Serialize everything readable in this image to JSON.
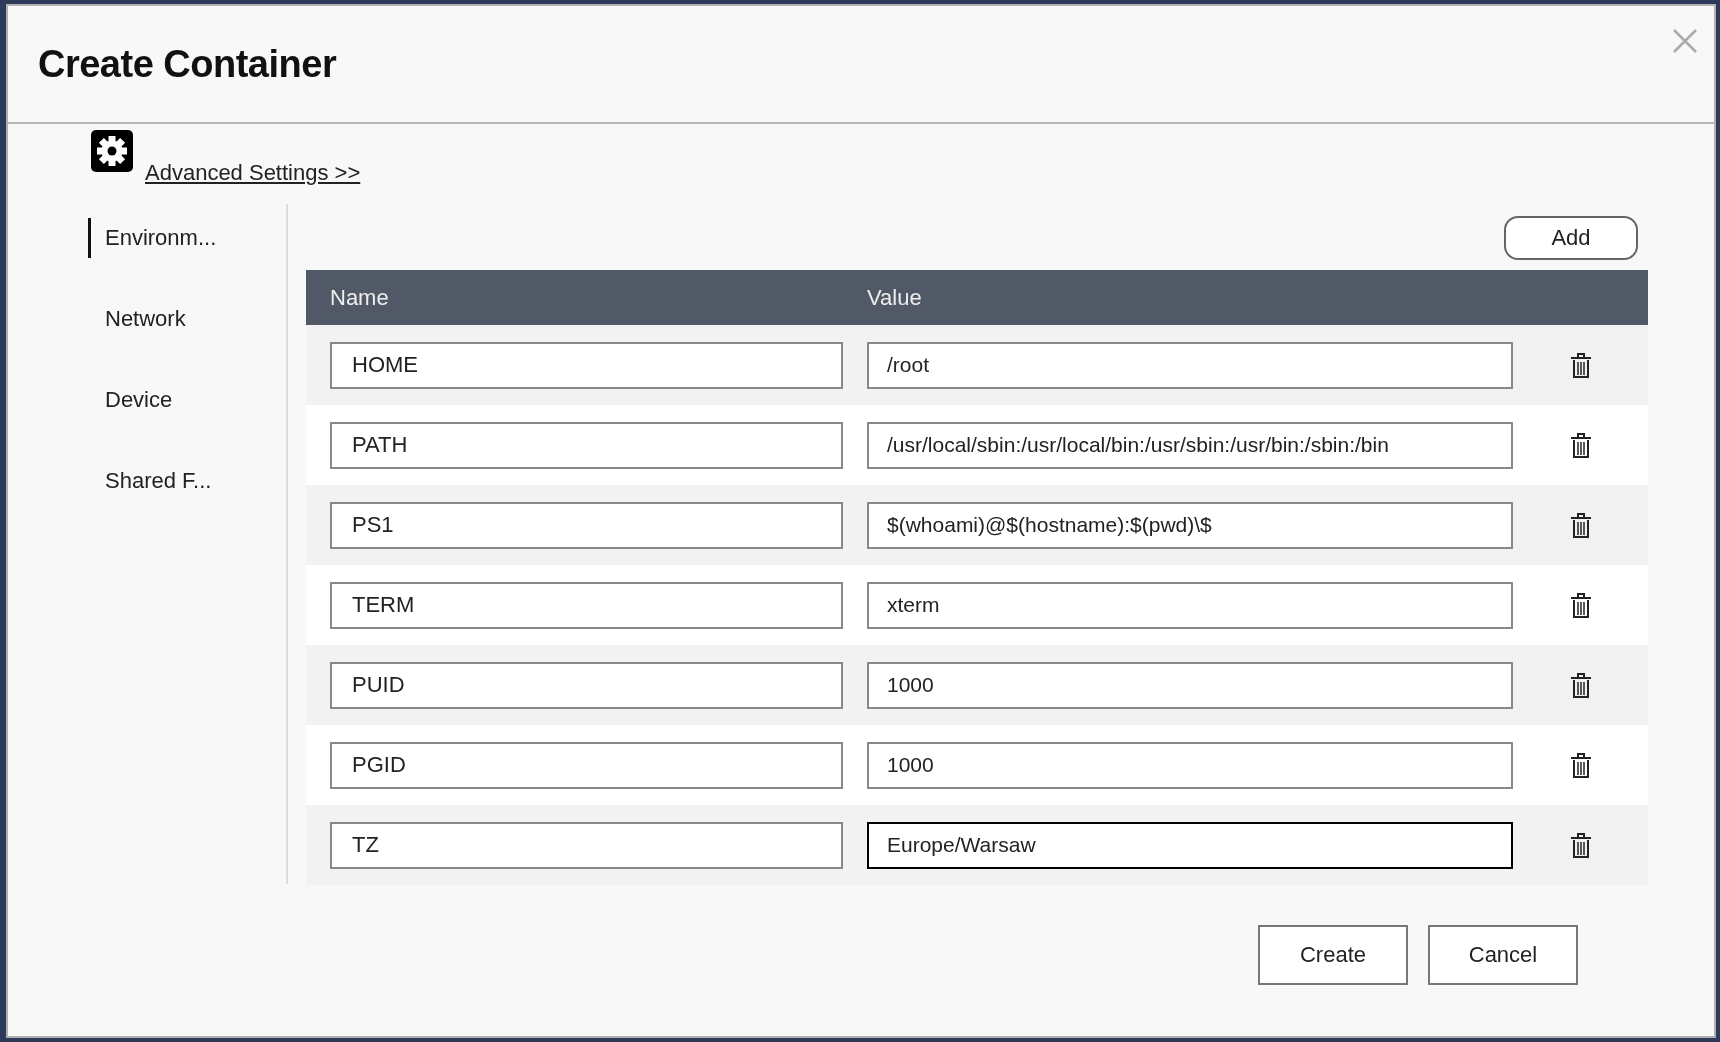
{
  "dialog": {
    "title": "Create Container",
    "advanced_link": "Advanced Settings >>"
  },
  "sidebar": {
    "items": [
      {
        "label": "Environm...",
        "selected": true
      },
      {
        "label": "Network",
        "selected": false
      },
      {
        "label": "Device",
        "selected": false
      },
      {
        "label": "Shared F...",
        "selected": false
      }
    ]
  },
  "add_button": "Add",
  "table": {
    "columns": [
      "Name",
      "Value"
    ],
    "rows": [
      {
        "name": "HOME",
        "value": "/root",
        "focused": false
      },
      {
        "name": "PATH",
        "value": "/usr/local/sbin:/usr/local/bin:/usr/sbin:/usr/bin:/sbin:/bin",
        "focused": false
      },
      {
        "name": "PS1",
        "value": "$(whoami)@$(hostname):$(pwd)\\$",
        "focused": false
      },
      {
        "name": "TERM",
        "value": "xterm",
        "focused": false
      },
      {
        "name": "PUID",
        "value": "1000",
        "focused": false
      },
      {
        "name": "PGID",
        "value": "1000",
        "focused": false
      },
      {
        "name": "TZ",
        "value": "Europe/Warsaw",
        "focused": true
      }
    ]
  },
  "buttons": [
    {
      "label": "Create"
    },
    {
      "label": "Cancel"
    }
  ]
}
